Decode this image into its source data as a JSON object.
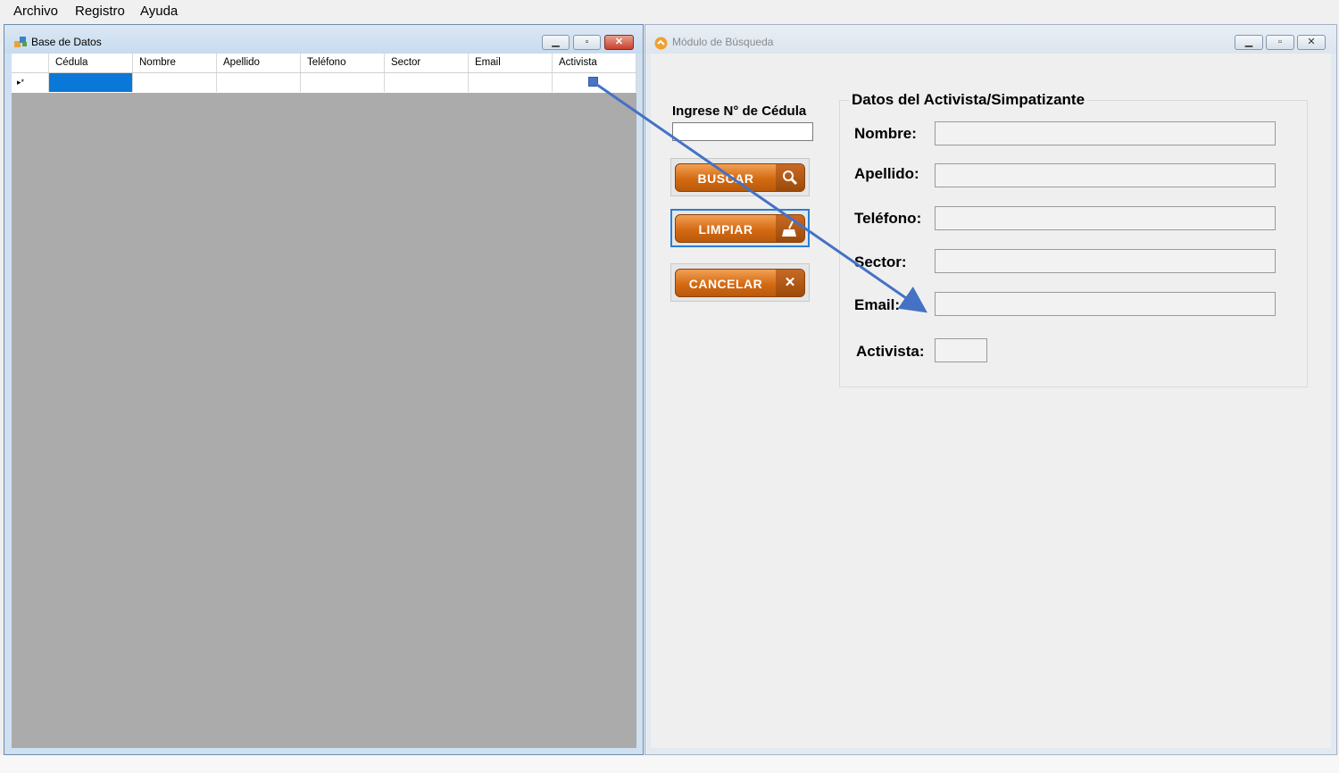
{
  "menu": [
    "Archivo",
    "Registro",
    "Ayuda"
  ],
  "left_window": {
    "title": "Base de Datos",
    "grid": {
      "columns": [
        "Cédula",
        "Nombre",
        "Apellido",
        "Teléfono",
        "Sector",
        "Email",
        "Activista"
      ],
      "new_row_marker": "▸*"
    }
  },
  "right_window": {
    "title": "Módulo de Búsqueda",
    "cedula_label": "Ingrese N° de Cédula",
    "cedula_value": "",
    "buttons": {
      "buscar": "BUSCAR",
      "limpiar": "LIMPIAR",
      "cancelar": "CANCELAR"
    },
    "group_title": "Datos del Activista/Simpatizante",
    "fields": {
      "nombre": "Nombre:",
      "apellido": "Apellido:",
      "telefono": "Teléfono:",
      "sector": "Sector:",
      "email": "Email:",
      "activista": "Activista:"
    }
  },
  "icons": {
    "left_window": "database-icon",
    "right_window": "search-module-icon",
    "buscar": "magnifier-icon",
    "limpiar": "broom-icon",
    "cancelar": "x-icon"
  },
  "colors": {
    "button_orange": "#d46a12",
    "selection_blue": "#0a78d7",
    "annotation_arrow": "#4472c4",
    "grid_background": "#ababab"
  }
}
